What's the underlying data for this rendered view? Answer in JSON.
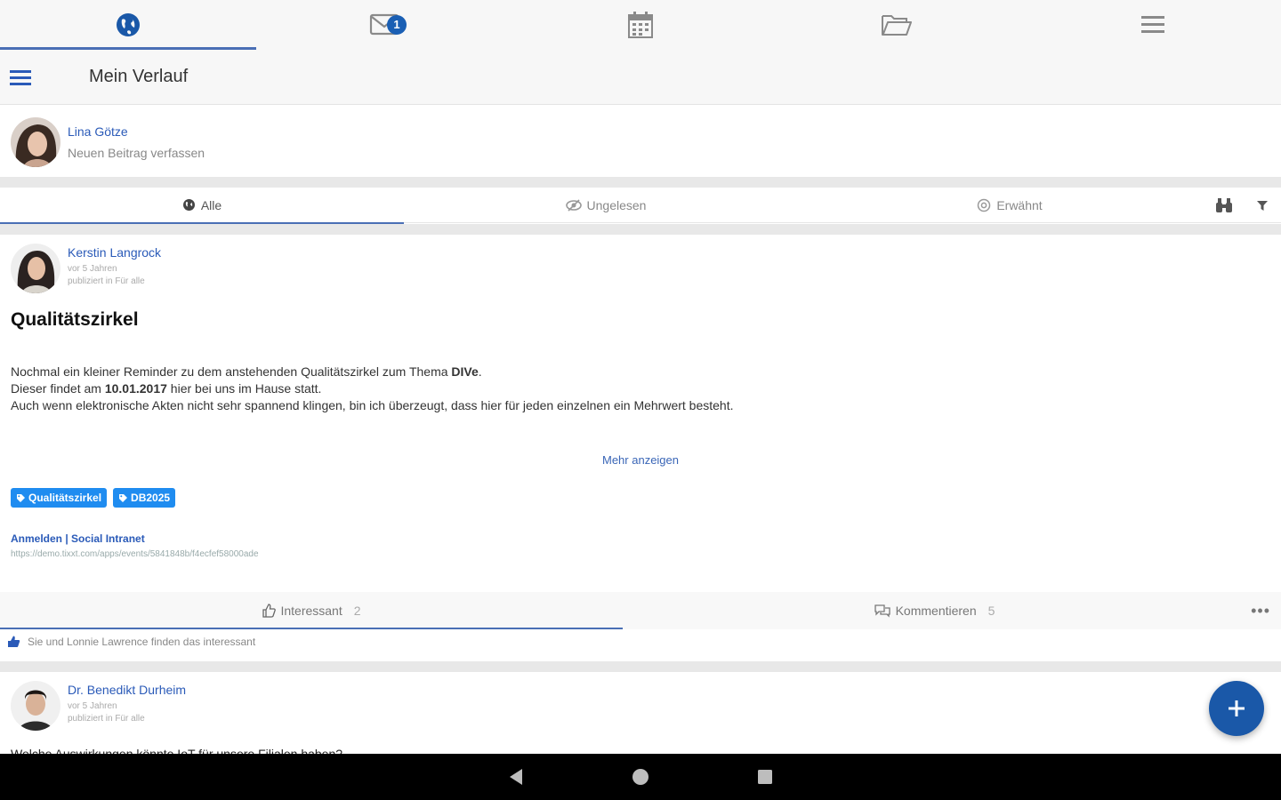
{
  "topnav": {
    "tabs": [
      {
        "icon": "globe-icon",
        "active": true
      },
      {
        "icon": "mail-icon",
        "badge": "1"
      },
      {
        "icon": "calendar-icon"
      },
      {
        "icon": "folder-icon"
      },
      {
        "icon": "menu-icon"
      }
    ]
  },
  "header": {
    "title": "Mein Verlauf"
  },
  "composer": {
    "user": "Lina Götze",
    "placeholder": "Neuen Beitrag verfassen"
  },
  "filters": {
    "all": "Alle",
    "unread": "Ungelesen",
    "mentioned": "Erwähnt"
  },
  "post": {
    "author": "Kerstin Langrock",
    "time": "vor 5 Jahren",
    "published": "publiziert in Für alle",
    "title": "Qualitätszirkel",
    "line1_pre": "Nochmal ein kleiner Reminder zu dem anstehenden Qualitätszirkel zum Thema ",
    "line1_bold": "DIVe",
    "line1_post": ".",
    "line2_pre": "Dieser findet am ",
    "line2_bold": "10.01.2017",
    "line2_post": " hier bei uns im Hause statt.",
    "line3": "Auch wenn elektronische Akten nicht sehr spannend klingen, bin ich überzeugt, dass hier für jeden einzelnen ein Mehrwert besteht.",
    "more": "Mehr anzeigen",
    "tags": [
      "Qualitätszirkel",
      "DB2025"
    ],
    "link_title": "Anmelden | Social Intranet",
    "link_url": "https://demo.tixxt.com/apps/events/5841848b/f4ecfef58000ade",
    "interesting_label": "Interessant",
    "interesting_count": "2",
    "comment_label": "Kommentieren",
    "comment_count": "5",
    "likes_text": "Sie und Lonnie Lawrence finden das interessant"
  },
  "post2": {
    "author": "Dr. Benedikt Durheim",
    "time": "vor 5 Jahren",
    "published": "publiziert in Für alle",
    "cut_text": "Welche Auswirkungen könnte IoT für unsere Filialen haben?"
  },
  "colors": {
    "accent": "#1a58a8",
    "link": "#2a5ab8",
    "tag": "#1f8cf0"
  }
}
